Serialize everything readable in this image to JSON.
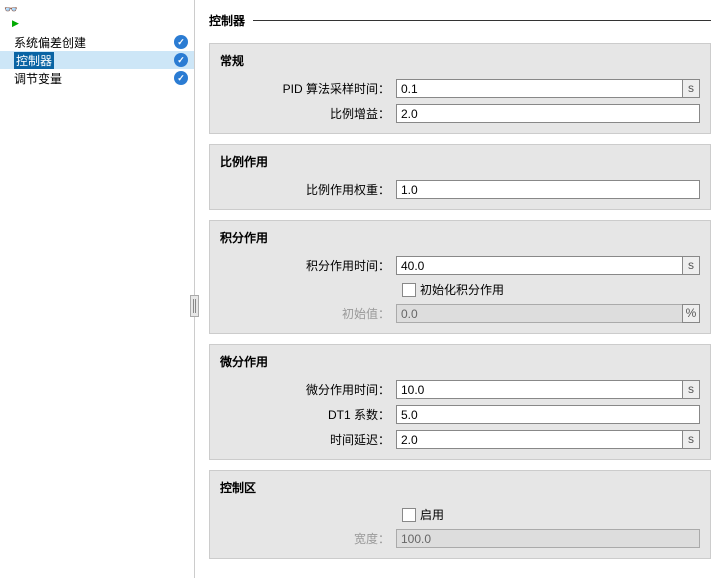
{
  "sidebar": {
    "items": [
      {
        "label": "系统偏差创建"
      },
      {
        "label": "控制器"
      },
      {
        "label": "调节变量"
      }
    ]
  },
  "page": {
    "title": "控制器"
  },
  "sections": {
    "general": {
      "title": "常规",
      "sample_time_label": "PID 算法采样时间：",
      "sample_time_value": "0.1",
      "sample_time_unit": "s",
      "gain_label": "比例增益：",
      "gain_value": "2.0"
    },
    "proportional": {
      "title": "比例作用",
      "weight_label": "比例作用权重：",
      "weight_value": "1.0"
    },
    "integral": {
      "title": "积分作用",
      "time_label": "积分作用时间：",
      "time_value": "40.0",
      "time_unit": "s",
      "init_checkbox_label": "初始化积分作用",
      "initial_label": "初始值：",
      "initial_value": "0.0",
      "initial_unit": "%"
    },
    "derivative": {
      "title": "微分作用",
      "time_label": "微分作用时间：",
      "time_value": "10.0",
      "time_unit": "s",
      "dt1_label": "DT1 系数：",
      "dt1_value": "5.0",
      "delay_label": "时间延迟：",
      "delay_value": "2.0",
      "delay_unit": "s"
    },
    "control_zone": {
      "title": "控制区",
      "enable_label": "启用",
      "width_label": "宽度：",
      "width_value": "100.0"
    }
  }
}
